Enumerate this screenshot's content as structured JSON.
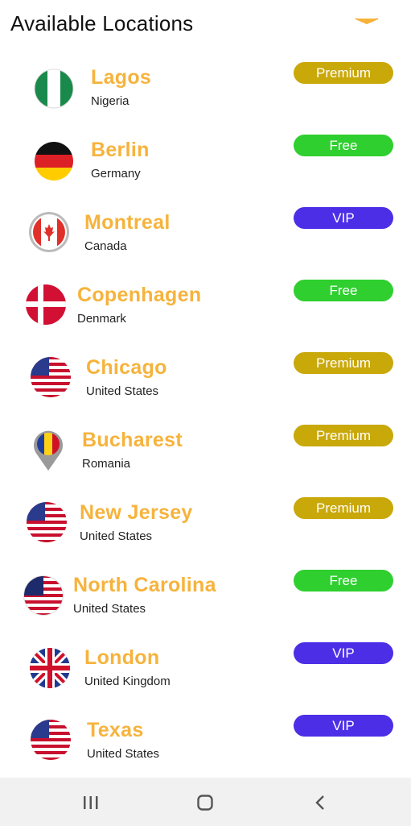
{
  "header": {
    "title": "Available Locations"
  },
  "colors": {
    "city": "#f6b33c",
    "premium": "#c9a80a",
    "free": "#2fcf2f",
    "vip": "#4b2ee6"
  },
  "locations": [
    {
      "city": "Lagos",
      "country": "Nigeria",
      "tier": "Premium",
      "flag": "nigeria-flag-icon"
    },
    {
      "city": "Berlin",
      "country": "Germany",
      "tier": "Free",
      "flag": "germany-flag-icon"
    },
    {
      "city": "Montreal",
      "country": "Canada",
      "tier": "VIP",
      "flag": "canada-flag-icon"
    },
    {
      "city": "Copenhagen",
      "country": "Denmark",
      "tier": "Free",
      "flag": "denmark-flag-icon"
    },
    {
      "city": "Chicago",
      "country": "United States",
      "tier": "Premium",
      "flag": "usa-flag-icon"
    },
    {
      "city": "Bucharest",
      "country": "Romania",
      "tier": "Premium",
      "flag": "romania-pin-icon"
    },
    {
      "city": "New Jersey",
      "country": "United States",
      "tier": "Premium",
      "flag": "usa-flag-icon"
    },
    {
      "city": "North Carolina",
      "country": "United States",
      "tier": "Free",
      "flag": "usa-flag-icon"
    },
    {
      "city": "London",
      "country": "United Kingdom",
      "tier": "VIP",
      "flag": "uk-flag-icon"
    },
    {
      "city": "Texas",
      "country": "United States",
      "tier": "VIP",
      "flag": "usa-flag-icon"
    }
  ],
  "navbar": {
    "icons": [
      "recent-apps-icon",
      "home-icon",
      "back-icon"
    ]
  }
}
